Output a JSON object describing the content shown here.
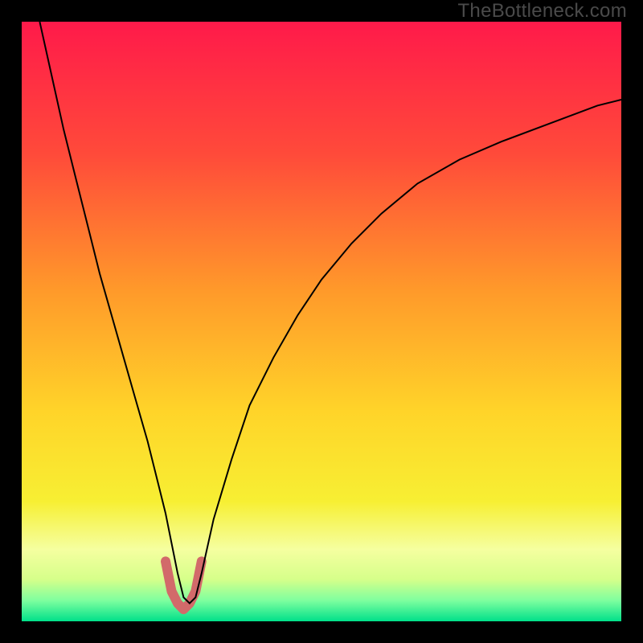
{
  "watermark": "TheBottleneck.com",
  "chart_data": {
    "type": "line",
    "title": "",
    "xlabel": "",
    "ylabel": "",
    "xlim": [
      0,
      100
    ],
    "ylim": [
      0,
      100
    ],
    "background_gradient": {
      "type": "vertical",
      "stops": [
        {
          "pos": 0.0,
          "color": "#ff1a4a"
        },
        {
          "pos": 0.22,
          "color": "#ff4a3a"
        },
        {
          "pos": 0.45,
          "color": "#ff9a2a"
        },
        {
          "pos": 0.65,
          "color": "#ffd429"
        },
        {
          "pos": 0.8,
          "color": "#f7ef33"
        },
        {
          "pos": 0.88,
          "color": "#f5ffa0"
        },
        {
          "pos": 0.93,
          "color": "#d6ff8a"
        },
        {
          "pos": 0.965,
          "color": "#7fff9f"
        },
        {
          "pos": 1.0,
          "color": "#00e08a"
        }
      ]
    },
    "series": [
      {
        "name": "main-curve",
        "color": "#000000",
        "stroke_width": 2,
        "x": [
          3,
          5,
          7,
          9,
          11,
          13,
          15,
          17,
          19,
          21,
          23,
          24,
          25,
          26,
          27,
          28,
          29,
          30,
          32,
          35,
          38,
          42,
          46,
          50,
          55,
          60,
          66,
          73,
          80,
          88,
          96,
          100
        ],
        "values": [
          100,
          91,
          82,
          74,
          66,
          58,
          51,
          44,
          37,
          30,
          22,
          18,
          13,
          8,
          4,
          3,
          4,
          8,
          17,
          27,
          36,
          44,
          51,
          57,
          63,
          68,
          73,
          77,
          80,
          83,
          86,
          87
        ]
      },
      {
        "name": "valley-highlight",
        "color": "#d26a6a",
        "stroke_width": 12,
        "linecap": "round",
        "x": [
          24,
          25,
          26,
          27,
          28,
          29,
          30
        ],
        "values": [
          10,
          5,
          3,
          2,
          3,
          5,
          10
        ]
      }
    ]
  }
}
